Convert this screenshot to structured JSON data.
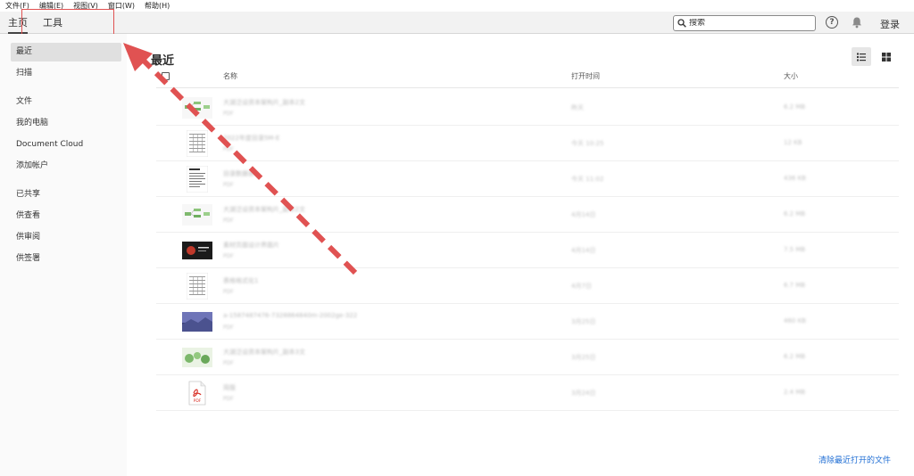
{
  "menubar": [
    "文件(F)",
    "编辑(E)",
    "视图(V)",
    "窗口(W)",
    "帮助(H)"
  ],
  "tabs": {
    "home": "主页",
    "tools": "工具"
  },
  "search": {
    "placeholder": "搜索"
  },
  "help_label": "?",
  "login_label": "登录",
  "sidebar": {
    "items": [
      "最近",
      "扫描",
      "文件",
      "我的电脑",
      "Document Cloud",
      "添加帐户",
      "已共享",
      "供查看",
      "供审阅",
      "供签署"
    ],
    "active_index": 0
  },
  "main": {
    "title": "最近",
    "columns": {
      "name": "名称",
      "time": "打开时间",
      "size": "大小"
    },
    "files": [
      {
        "name": "大湖泛设资本架构片_副本2文",
        "type": "PDF",
        "time": "昨天",
        "size": "6.2 MB",
        "thumb": "green-diagram"
      },
      {
        "name": "2022年度目录5M-E",
        "type": "PDF",
        "time": "今天 10:25",
        "size": "12 KB",
        "thumb": "table-doc"
      },
      {
        "name": "目录数据表",
        "type": "PDF",
        "time": "今天 11:02",
        "size": "436 KB",
        "thumb": "text-doc"
      },
      {
        "name": "大湖泛设资本架构片_副本2文",
        "type": "PDF",
        "time": "4月14日",
        "size": "6.2 MB",
        "thumb": "green-diagram"
      },
      {
        "name": "素材页面设计界面片",
        "type": "PDF",
        "time": "4月14日",
        "size": "7.5 MB",
        "thumb": "dark-slide"
      },
      {
        "name": "表格格式化1",
        "type": "PDF",
        "time": "4月7日",
        "size": "6.7 MB",
        "thumb": "table-doc"
      },
      {
        "name": "a-1587487476-7328864840m-2002ge-322",
        "type": "PDF",
        "time": "3月25日",
        "size": "460 KB",
        "thumb": "landscape"
      },
      {
        "name": "大湖泛设资本架构片_副本3文",
        "type": "PDF",
        "time": "3月25日",
        "size": "6.2 MB",
        "thumb": "green-photo"
      },
      {
        "name": "简版",
        "type": "PDF",
        "time": "3月24日",
        "size": "2.4 MB",
        "thumb": "pdf-icon"
      }
    ]
  },
  "clear_recent_label": "清除最近打开的文件",
  "pdf_icon_text": "PDF",
  "colors": {
    "accent": "#1f6ed4",
    "annotation": "#e05252",
    "active_nav": "#e0e0e0"
  }
}
